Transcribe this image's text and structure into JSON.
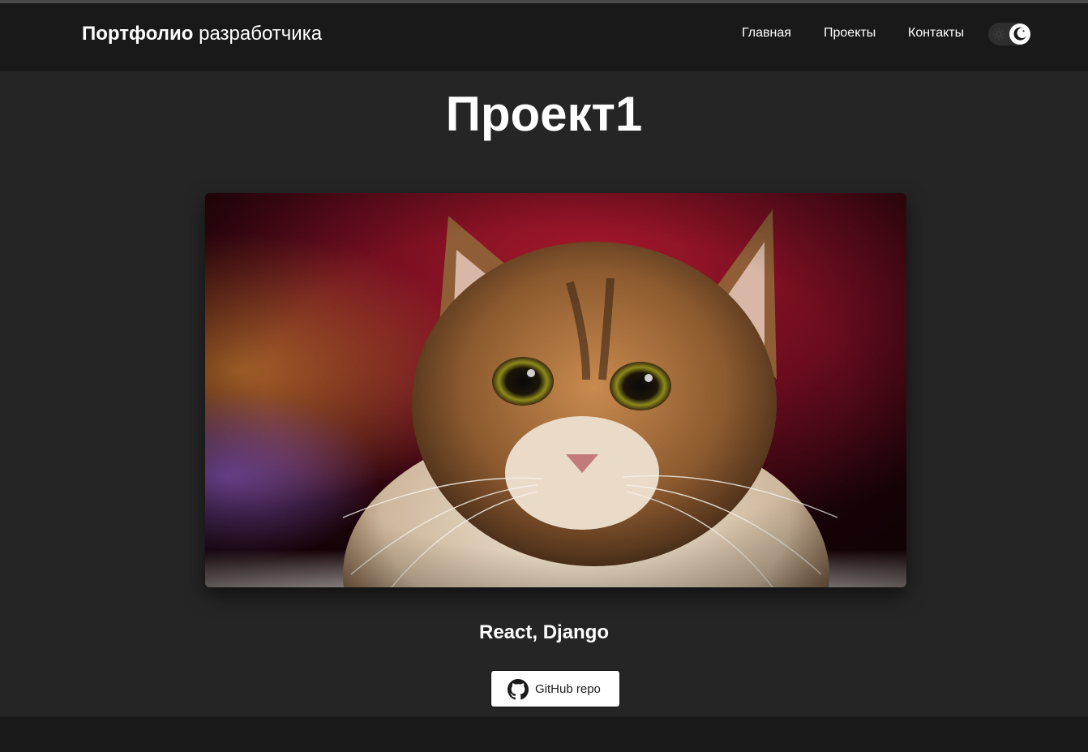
{
  "header": {
    "brand_bold": "Портфолио",
    "brand_regular": "разработчика",
    "nav": {
      "home": "Главная",
      "projects": "Проекты",
      "contacts": "Контакты"
    },
    "theme_toggle": {
      "left_icon": "sun-icon",
      "right_icon": "moon-icon",
      "mode": "dark"
    }
  },
  "project": {
    "title": "Проект1",
    "image": {
      "subject": "cat-photo"
    },
    "stack": "React, Django",
    "github_button": {
      "label": "GitHub repo",
      "icon": "github-icon"
    }
  },
  "colors": {
    "navbar_bg": "#191919",
    "page_bg": "#252525",
    "text": "#ffffff",
    "button_bg": "#ffffff",
    "button_text": "#1a1a1a"
  }
}
